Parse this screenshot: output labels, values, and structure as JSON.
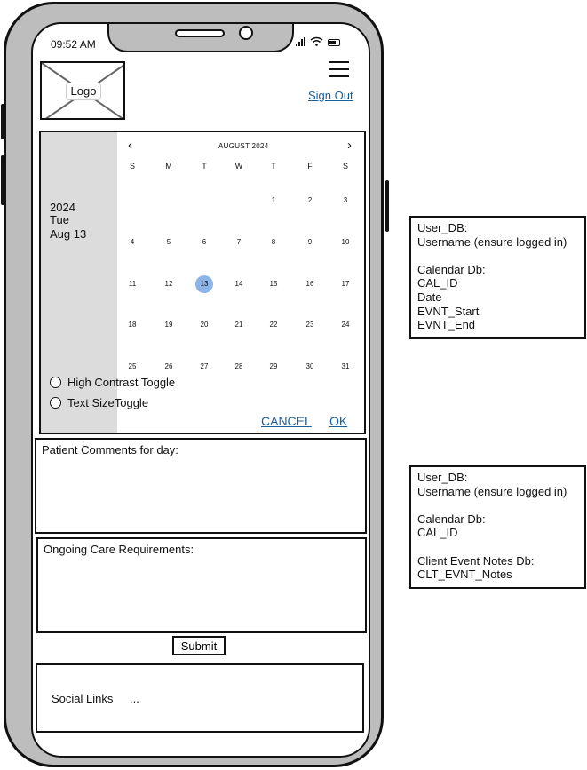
{
  "status_bar": {
    "time": "09:52 AM"
  },
  "header": {
    "logo_label": "Logo",
    "sign_out": "Sign Out"
  },
  "calendar": {
    "side_year": "2024",
    "side_weekday": "Tue",
    "side_date": "Aug 13",
    "month_label": "AUGUST 2024",
    "prev_icon": "‹",
    "next_icon": "›",
    "weekdays": [
      "S",
      "M",
      "T",
      "W",
      "T",
      "F",
      "S"
    ],
    "selected_day": "13",
    "weeks": [
      [
        "",
        "",
        "",
        "",
        "1",
        "2",
        "3"
      ],
      [
        "4",
        "5",
        "6",
        "7",
        "8",
        "9",
        "10"
      ],
      [
        "11",
        "12",
        "13",
        "14",
        "15",
        "16",
        "17"
      ],
      [
        "18",
        "19",
        "20",
        "21",
        "22",
        "23",
        "24"
      ],
      [
        "25",
        "26",
        "27",
        "28",
        "29",
        "30",
        "31"
      ]
    ],
    "high_contrast_label": "High Contrast Toggle",
    "text_size_label": "Text SizeToggle",
    "cancel_label": "CANCEL",
    "ok_label": "OK",
    "selected_color": "#8db4e8"
  },
  "form": {
    "comments_label": "Patient Comments for day:",
    "care_label": "Ongoing Care Requirements:",
    "submit_label": "Submit"
  },
  "footer": {
    "social_label": "Social Links",
    "social_more": "..."
  },
  "notes": [
    [
      "User_DB:",
      "Username (ensure logged in)",
      "",
      "Calendar Db:",
      "CAL_ID",
      "Date",
      "EVNT_Start",
      "EVNT_End"
    ],
    [
      "User_DB:",
      "Username (ensure logged in)",
      "",
      "Calendar Db:",
      "CAL_ID",
      "",
      "Client Event Notes Db:",
      "CLT_EVNT_Notes"
    ]
  ],
  "colors": {
    "link": "#1a5f9a",
    "frame": "#bdbdbd",
    "calendar_side": "#dcdcdc"
  }
}
